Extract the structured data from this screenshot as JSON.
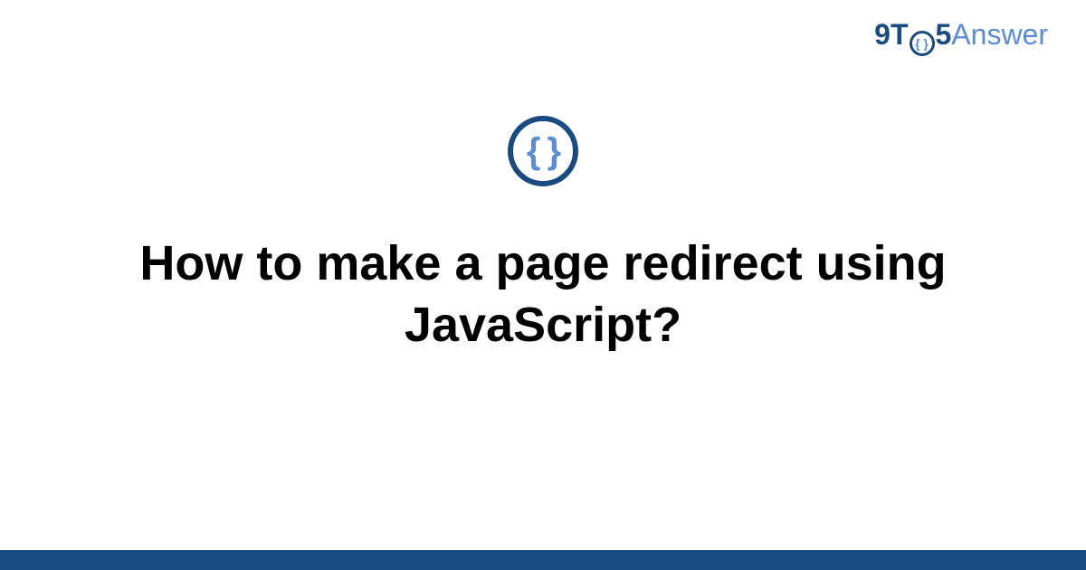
{
  "logo": {
    "part1": "9T",
    "circle_glyph": "{ }",
    "part2": "5",
    "part3": "Answer"
  },
  "topic": {
    "glyph": "{ }"
  },
  "title": "How to make a page redirect using JavaScript?",
  "colors": {
    "brand_dark": "#194a82",
    "brand_light": "#5b8dd6"
  }
}
